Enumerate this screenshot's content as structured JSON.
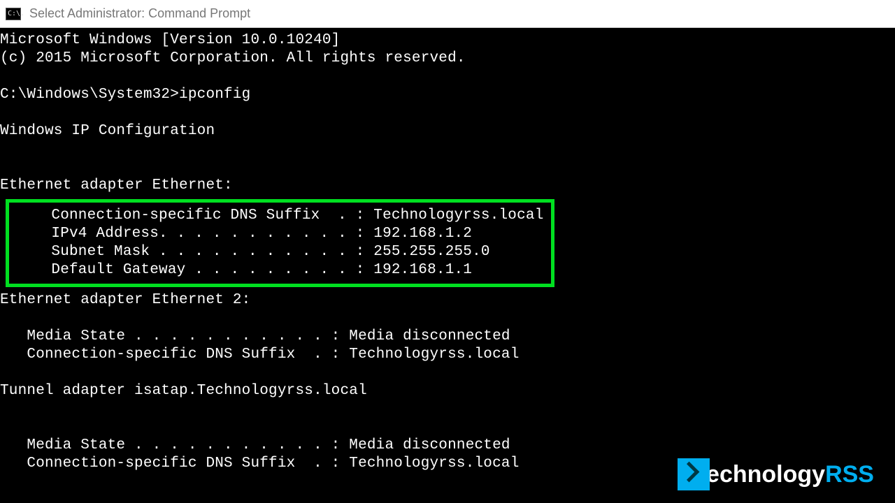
{
  "window": {
    "icon_label": "C:\\.",
    "title": "Select Administrator: Command Prompt"
  },
  "terminal": {
    "banner1": "Microsoft Windows [Version 10.0.10240]",
    "banner2": "(c) 2015 Microsoft Corporation. All rights reserved.",
    "prompt_line": "C:\\Windows\\System32>ipconfig",
    "ipcfg_header": "Windows IP Configuration",
    "adapter1_header": "Ethernet adapter Ethernet:",
    "adapter1": {
      "dns": "   Connection-specific DNS Suffix  . : Technologyrss.local",
      "ipv4": "   IPv4 Address. . . . . . . . . . . : 192.168.1.2",
      "subnet": "   Subnet Mask . . . . . . . . . . . : 255.255.255.0",
      "gateway": "   Default Gateway . . . . . . . . . : 192.168.1.1"
    },
    "adapter2_header": "Ethernet adapter Ethernet 2:",
    "adapter2": {
      "media": "   Media State . . . . . . . . . . . : Media disconnected",
      "dns": "   Connection-specific DNS Suffix  . : Technologyrss.local"
    },
    "tunnel_header": "Tunnel adapter isatap.Technologyrss.local",
    "tunnel": {
      "media": "   Media State . . . . . . . . . . . : Media disconnected",
      "dns": "   Connection-specific DNS Suffix  . : Technologyrss.local"
    }
  },
  "watermark": {
    "text1": "echnology",
    "text2": "RSS"
  }
}
